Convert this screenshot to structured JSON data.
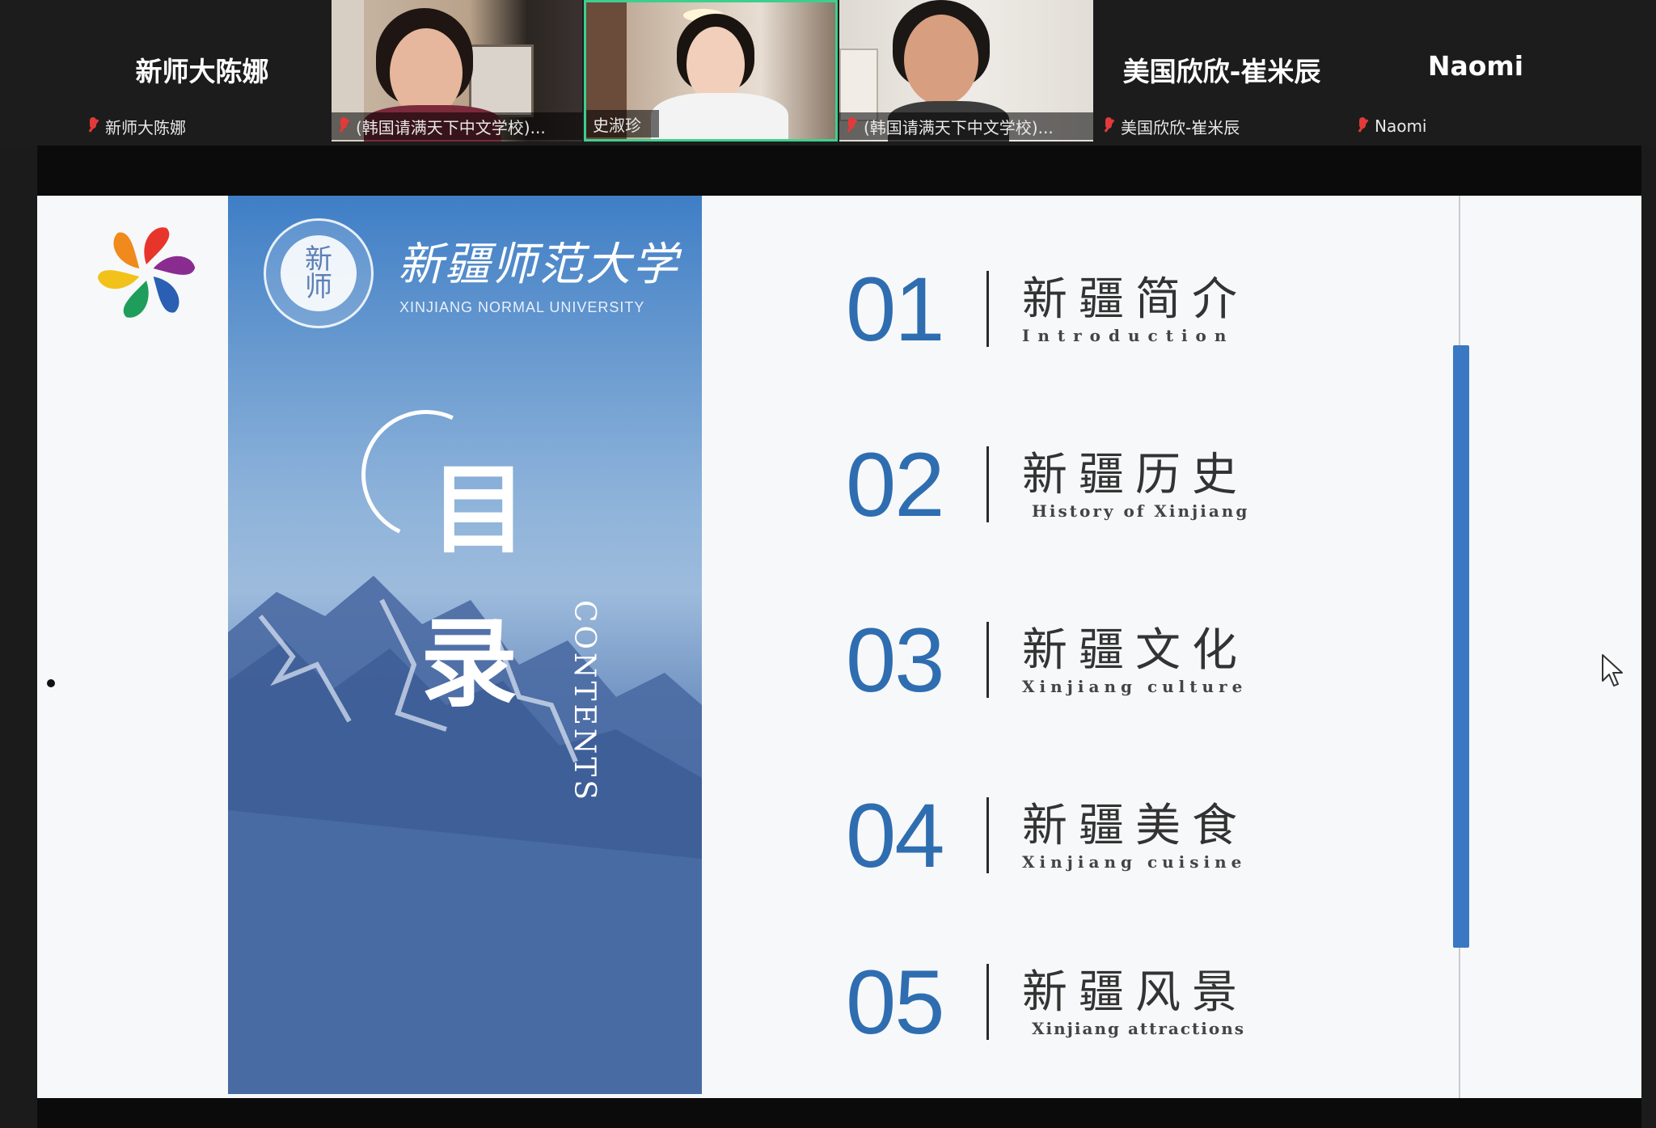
{
  "participants": [
    {
      "big_name": "新师大陈娜",
      "label": "新师大陈娜",
      "video": false
    },
    {
      "label": "(韩国请满天下中文学校)...",
      "video": true
    },
    {
      "label": "史淑珍",
      "video": true
    },
    {
      "label": "(韩国请满天下中文学校)...",
      "video": true
    },
    {
      "big_name": "美国欣欣-崔米辰",
      "label": "美国欣欣-崔米辰",
      "video": false
    },
    {
      "big_name": "Naomi",
      "label": "Naomi",
      "video": false
    }
  ],
  "slide": {
    "cover": {
      "seal_text": "新\n师",
      "university_cn": "新疆师范大学",
      "university_en": "XINJIANG NORMAL UNIVERSITY",
      "title_char_1": "目",
      "title_char_2": "录",
      "title_en": "CONTENTS"
    },
    "toc": [
      {
        "num": "01",
        "cn": "新疆简介",
        "en": "Introduction"
      },
      {
        "num": "02",
        "cn": "新疆历史",
        "en": "History of Xinjiang"
      },
      {
        "num": "03",
        "cn": "新疆文化",
        "en": "Xinjiang culture"
      },
      {
        "num": "04",
        "cn": "新疆美食",
        "en": "Xinjiang cuisine"
      },
      {
        "num": "05",
        "cn": "新疆风景",
        "en": "Xinjiang attractions"
      }
    ]
  },
  "colors": {
    "accent": "#2f6db1",
    "scroll_thumb": "#3a78c4",
    "muted_mic": "#e23a3a",
    "active_speaker_border": "#3ecf8e"
  },
  "icons": {
    "mic_muted": "mic-muted-icon",
    "cursor": "mouse-pointer-icon",
    "logo": "flower-logo-icon"
  }
}
